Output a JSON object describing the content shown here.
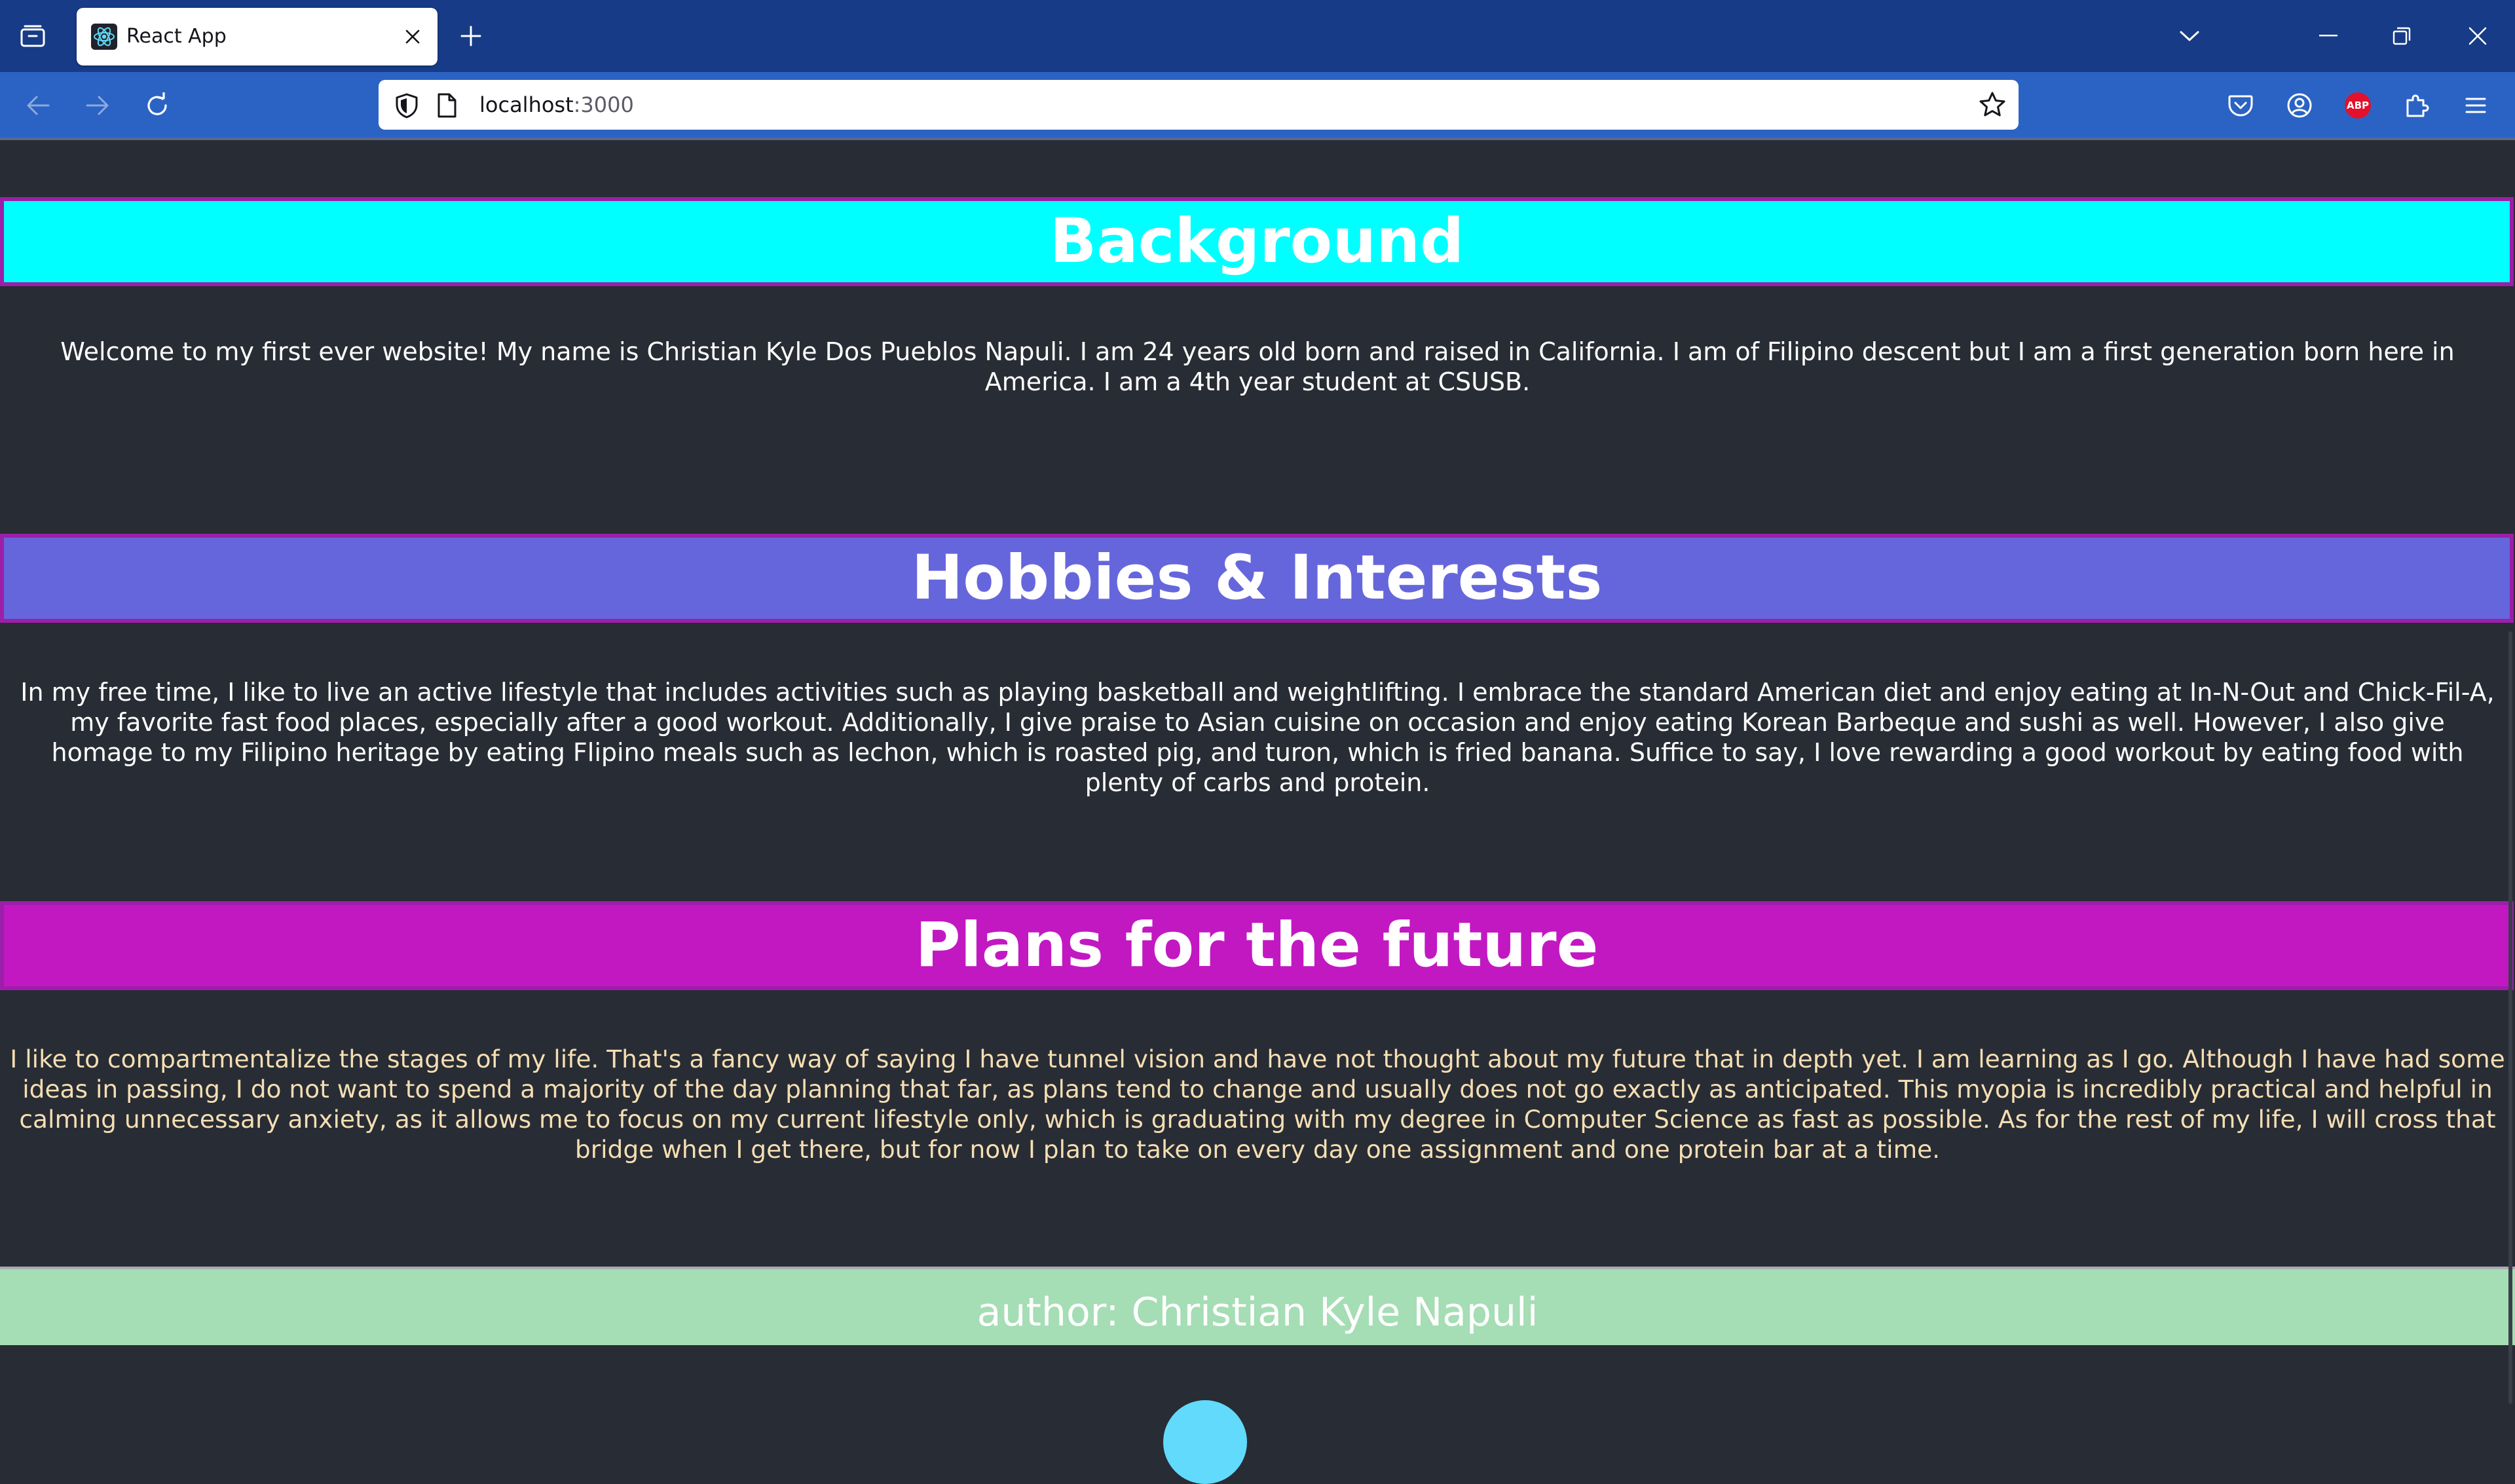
{
  "browser": {
    "tab_title": "React App",
    "url_host": "localhost",
    "url_port": ":3000",
    "icons": {
      "overview": "tab-overview-icon",
      "favicon": "react-logo-icon",
      "tab_close": "close-icon",
      "new_tab": "plus-icon",
      "list_tabs": "chevron-down-icon",
      "back": "arrow-left-icon",
      "forward": "arrow-right-icon",
      "reload": "reload-icon",
      "shield": "shield-icon",
      "page": "page-icon",
      "bookmark": "star-icon",
      "pocket": "pocket-icon",
      "account": "account-icon",
      "adblock": "abp-icon",
      "extensions": "puzzle-icon",
      "menu": "hamburger-menu-icon"
    },
    "abp_label": "ABP",
    "colors": {
      "tabbar": "#173b86",
      "navbar": "#2b63c4"
    }
  },
  "sections": [
    {
      "heading": "Background",
      "color": "#00ffff",
      "text": "Welcome to my first ever website! My name is Christian Kyle Dos Pueblos Napuli. I am 24 years old born and raised in California. I am of Filipino descent but I am a first generation born here in America. I am a 4th year student at CSUSB."
    },
    {
      "heading": "Hobbies & Interests",
      "color": "#6666dc",
      "text": "In my free time, I like to live an active lifestyle that includes activities such as playing basketball and weightlifting. I embrace the standard American diet and enjoy eating at In-N-Out and Chick-Fil-A, my favorite fast food places, especially after a good workout. Additionally, I give praise to Asian cuisine on occasion and enjoy eating Korean Barbeque and sushi as well. However, I also give homage to my Filipino heritage by eating Flipino meals such as lechon, which is roasted pig, and turon, which is fried banana. Suffice to say, I love rewarding a good workout by eating food with plenty of carbs and protein."
    },
    {
      "heading": "Plans for the future",
      "color": "#c218c2",
      "text": "I like to compartmentalize the stages of my life. That's a fancy way of saying I have tunnel vision and have not thought about my future that in depth yet. I am learning as I go. Although I have had some ideas in passing, I do not want to spend a majority of the day planning that far, as plans tend to change and usually does not go exactly as anticipated. This myopia is incredibly practical and helpful in calming unnecessary anxiety, as it allows me to focus on my current lifestyle only, which is graduating with my degree in Computer Science as fast as possible. As for the rest of my life, I will cross that bridge when I get there, but for now I plan to take on every day one assignment and one protein bar at a time."
    }
  ],
  "footer": {
    "author": "author: Christian Kyle Napuli",
    "color": "#a5ddb4"
  }
}
